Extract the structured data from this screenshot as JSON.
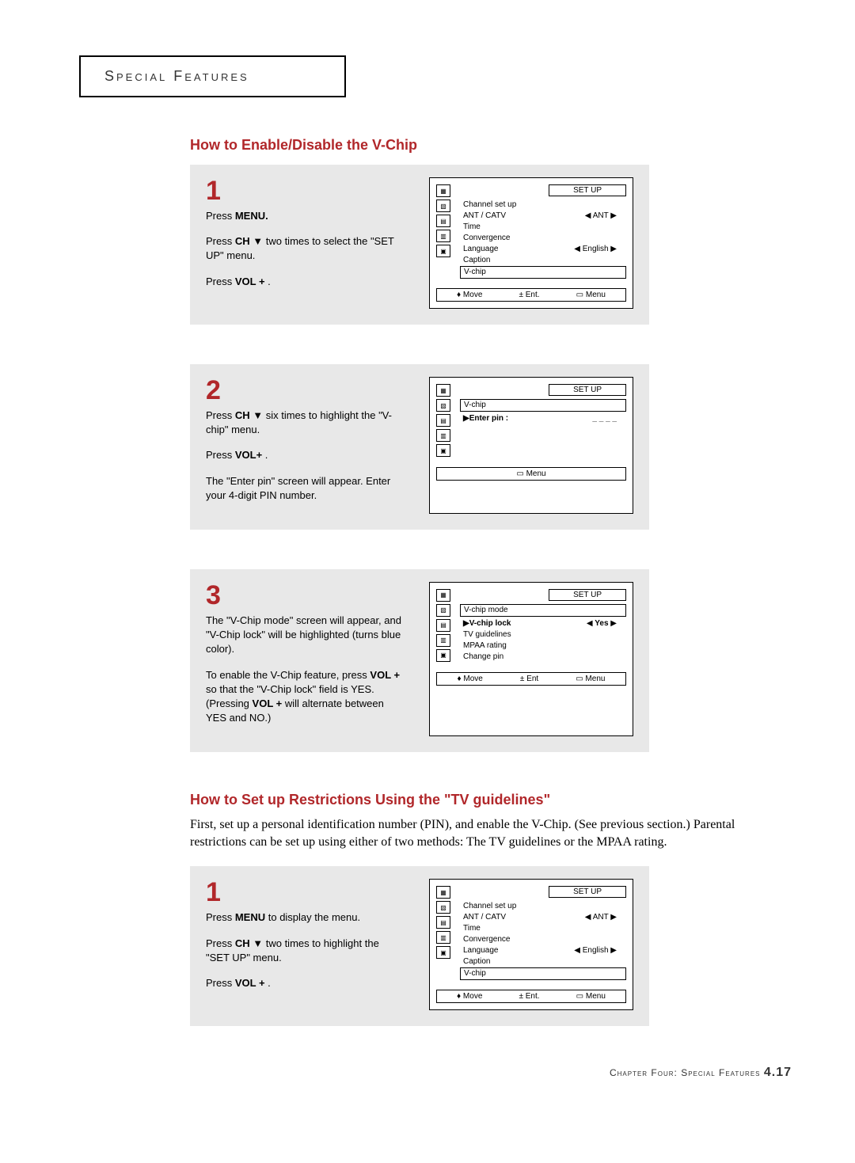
{
  "header": "Special Features",
  "title_a": "How to Enable/Disable the V-Chip",
  "steps_a": [
    {
      "num": "1",
      "paras": [
        {
          "pre": "Press ",
          "bold": "MENU.",
          "post": ""
        },
        {
          "pre": "Press ",
          "bold": "CH ▼",
          "post": " two times to select the \"SET UP\" menu."
        },
        {
          "pre": "Press ",
          "bold": "VOL +",
          "post": " ."
        }
      ],
      "screen": {
        "title": "SET UP",
        "items": [
          {
            "label": "Channel set up",
            "val": "",
            "left": "",
            "right": "",
            "hl": false
          },
          {
            "label": "ANT / CATV",
            "val": "ANT",
            "left": "◀",
            "right": "▶",
            "hl": false
          },
          {
            "label": "Time",
            "val": "",
            "left": "",
            "right": "",
            "hl": false
          },
          {
            "label": "Convergence",
            "val": "",
            "left": "",
            "right": "",
            "hl": false
          },
          {
            "label": "Language",
            "val": "English",
            "left": "◀",
            "right": "▶",
            "hl": false
          },
          {
            "label": "Caption",
            "val": "",
            "left": "",
            "right": "",
            "hl": false
          },
          {
            "label": "V-chip",
            "val": "",
            "left": "",
            "right": "",
            "hl": true
          }
        ],
        "footer": [
          "♦ Move",
          "± Ent.",
          "▭ Menu"
        ]
      }
    },
    {
      "num": "2",
      "paras": [
        {
          "pre": "Press ",
          "bold": "CH ▼",
          "post": " six times to highlight the \"V-chip\" menu."
        },
        {
          "pre": "Press ",
          "bold": "VOL+",
          "post": " ."
        },
        {
          "pre": "The \"Enter pin\" screen will appear. Enter your 4-digit PIN number.",
          "bold": "",
          "post": ""
        }
      ],
      "screen": {
        "title": "SET UP",
        "items": [
          {
            "label": "V-chip",
            "val": "",
            "left": "",
            "right": "",
            "hl": true
          },
          {
            "label": "▶Enter pin :",
            "val": "_ _ _ _",
            "left": "",
            "right": "",
            "hl": false,
            "bold": true
          }
        ],
        "footer": [
          "▭ Menu"
        ]
      }
    },
    {
      "num": "3",
      "paras": [
        {
          "pre": "The \"V-Chip mode\" screen will appear, and \"V-Chip lock\" will be highlighted (turns blue color).",
          "bold": "",
          "post": ""
        },
        {
          "pre": "To enable the V-Chip feature, press ",
          "bold": "VOL +",
          "post": " so that the \"V-Chip lock\" field is YES. (Pressing ",
          "bold2": "VOL +",
          "post2": " will alternate between YES and NO.)"
        }
      ],
      "screen": {
        "title": "SET UP",
        "items": [
          {
            "label": "V-chip mode",
            "val": "",
            "left": "",
            "right": "",
            "hl": true
          },
          {
            "label": "▶V-chip lock",
            "val": "Yes",
            "left": "◀",
            "right": "▶",
            "hl": false,
            "bold": true
          },
          {
            "label": "TV guidelines",
            "val": "",
            "left": "",
            "right": "",
            "hl": false
          },
          {
            "label": "MPAA rating",
            "val": "",
            "left": "",
            "right": "",
            "hl": false
          },
          {
            "label": "Change pin",
            "val": "",
            "left": "",
            "right": "",
            "hl": false
          }
        ],
        "footer": [
          "♦ Move",
          "± Ent",
          "▭ Menu"
        ]
      }
    }
  ],
  "title_b": "How to Set up Restrictions Using the \"TV guidelines\"",
  "body_b": "First, set up a personal identification number (PIN), and enable the V-Chip. (See previous section.)  Parental restrictions can be set up using either of two methods: The TV guidelines or the MPAA rating.",
  "steps_b": [
    {
      "num": "1",
      "paras": [
        {
          "pre": "Press ",
          "bold": "MENU",
          "post": " to display the menu."
        },
        {
          "pre": "Press ",
          "bold": "CH ▼",
          "post": " two times to highlight the \"SET UP\" menu."
        },
        {
          "pre": "Press ",
          "bold": "VOL +",
          "post": " ."
        }
      ],
      "screen": {
        "title": "SET UP",
        "items": [
          {
            "label": "Channel set up",
            "val": "",
            "left": "",
            "right": "",
            "hl": false
          },
          {
            "label": "ANT / CATV",
            "val": "ANT",
            "left": "◀",
            "right": "▶",
            "hl": false
          },
          {
            "label": "Time",
            "val": "",
            "left": "",
            "right": "",
            "hl": false
          },
          {
            "label": "Convergence",
            "val": "",
            "left": "",
            "right": "",
            "hl": false
          },
          {
            "label": "Language",
            "val": "English",
            "left": "◀",
            "right": "▶",
            "hl": false
          },
          {
            "label": "Caption",
            "val": "",
            "left": "",
            "right": "",
            "hl": false
          },
          {
            "label": "V-chip",
            "val": "",
            "left": "",
            "right": "",
            "hl": true
          }
        ],
        "footer": [
          "♦ Move",
          "± Ent.",
          "▭ Menu"
        ]
      }
    }
  ],
  "footer_text": "Chapter Four: Special Features",
  "footer_num": "4.17"
}
